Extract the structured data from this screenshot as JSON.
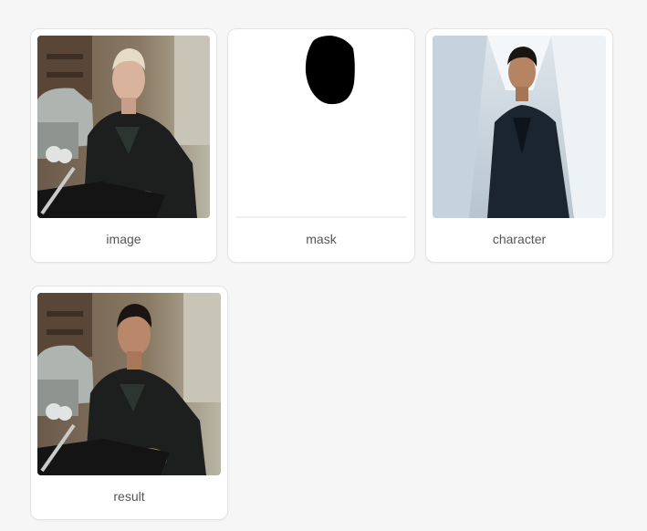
{
  "cards": [
    {
      "caption": "image",
      "image_alt": "man with blond hair in leather jacket sitting on motorcycle in garage"
    },
    {
      "caption": "mask",
      "image_alt": "white mask with black head-shaped region"
    },
    {
      "caption": "character",
      "image_alt": "man in dark suit in bright architectural space"
    },
    {
      "caption": "result",
      "image_alt": "dark-haired man in leather jacket sitting on motorcycle in garage"
    }
  ],
  "colors": {
    "background": "#f6f6f6",
    "card_border": "#e3e3e3",
    "caption_text": "#555555"
  }
}
